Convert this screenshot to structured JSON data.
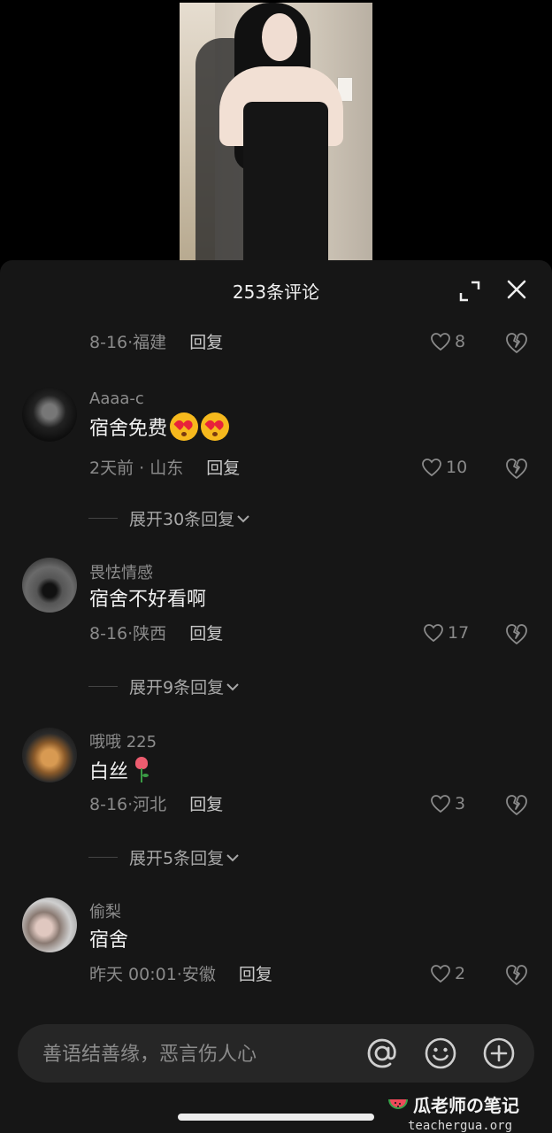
{
  "sheet": {
    "title": "253条评论"
  },
  "top_partial": {
    "time": "8-16",
    "location": "福建",
    "reply_label": "回复",
    "likes": "8"
  },
  "comments": [
    {
      "username": "Aaaa-c",
      "text": "宿舍免费",
      "time": "2天前",
      "location": "山东",
      "reply_label": "回复",
      "likes": "10",
      "expand_label": "展开30条回复"
    },
    {
      "username": "畏怯情感",
      "text": "宿舍不好看啊",
      "time": "8-16",
      "location": "陕西",
      "reply_label": "回复",
      "likes": "17",
      "expand_label": "展开9条回复"
    },
    {
      "username": "哦哦 225",
      "text": "白丝",
      "time": "8-16",
      "location": "河北",
      "reply_label": "回复",
      "likes": "3",
      "expand_label": "展开5条回复"
    },
    {
      "username": "偷梨",
      "text": "宿舍",
      "time": "昨天 00:01",
      "location": "安徽",
      "reply_label": "回复",
      "likes": "2"
    }
  ],
  "input": {
    "placeholder": "善语结善缘，恶言伤人心"
  },
  "watermark": {
    "title": "瓜老师の笔记",
    "url": "teachergua.org"
  },
  "icons": {
    "at": "at-icon",
    "emoji": "emoji-icon",
    "add": "plus-circle-icon"
  },
  "colors": {
    "sheet_bg": "#161616",
    "input_bg": "#262626",
    "muted_text": "#8a8a8a"
  }
}
